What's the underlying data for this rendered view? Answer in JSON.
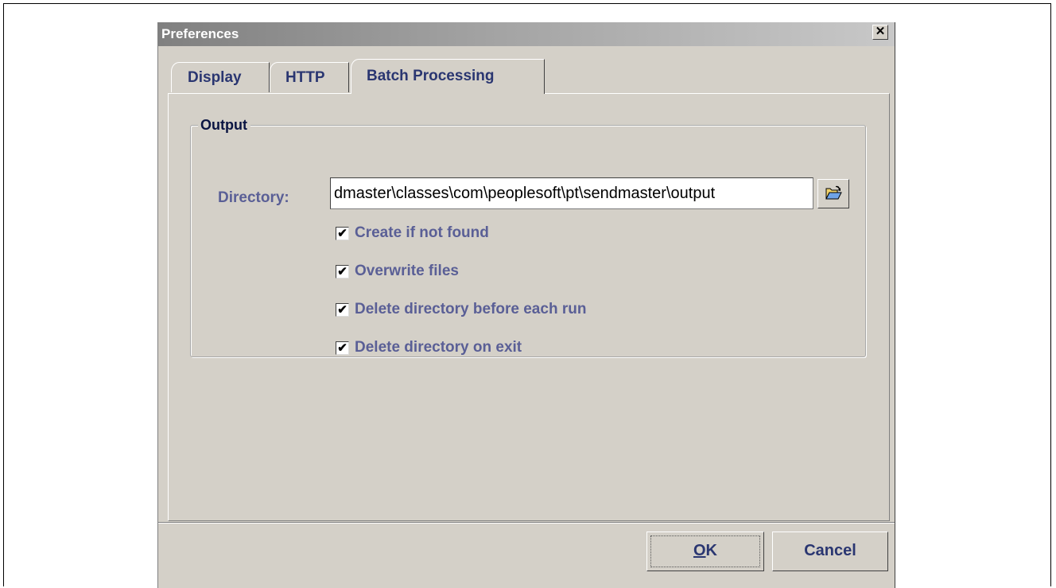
{
  "window": {
    "title": "Preferences",
    "close_glyph": "✕"
  },
  "tabs": [
    {
      "label": "Display",
      "active": false
    },
    {
      "label": "HTTP",
      "active": false
    },
    {
      "label": "Batch Processing",
      "active": true
    }
  ],
  "output": {
    "legend": "Output",
    "directory_label": "Directory:",
    "directory_value": "dmaster\\classes\\com\\peoplesoft\\pt\\sendmaster\\output",
    "browse_icon": "open-folder-icon",
    "options": [
      {
        "label": "Create if not found",
        "checked": true
      },
      {
        "label": "Overwrite files",
        "checked": true
      },
      {
        "label": "Delete directory before each run",
        "checked": true
      },
      {
        "label": "Delete directory on exit",
        "checked": true
      }
    ]
  },
  "buttons": {
    "ok_mnemonic": "O",
    "ok_rest": "K",
    "cancel": "Cancel"
  },
  "colors": {
    "dialog_bg": "#d4d0c8",
    "label_text": "#5a5f96",
    "tab_text": "#2a3671"
  }
}
